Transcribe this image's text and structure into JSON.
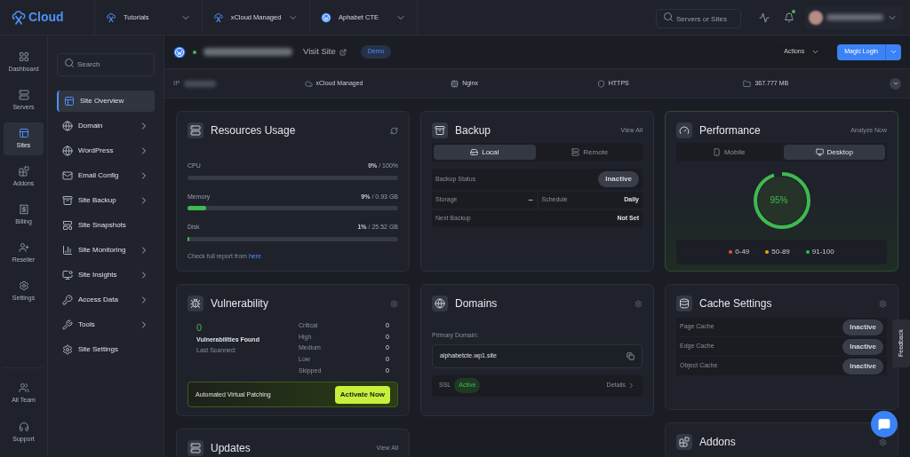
{
  "brand": {
    "name": "Cloud"
  },
  "breadcrumbs": [
    {
      "label": "Tutorials",
      "kind": "team"
    },
    {
      "label": "xCloud Managed",
      "kind": "server"
    },
    {
      "label": "Aphabet CTE",
      "kind": "site"
    }
  ],
  "top_search": {
    "placeholder": "Servers or Sites"
  },
  "notifications": {
    "unread": true
  },
  "rail": [
    {
      "label": "Dashboard",
      "kind": "dashboard",
      "selected": false
    },
    {
      "label": "Servers",
      "kind": "servers",
      "selected": false
    },
    {
      "label": "Sites",
      "kind": "sites",
      "selected": true
    },
    {
      "label": "Addons",
      "kind": "addons",
      "selected": false
    },
    {
      "label": "Billing",
      "kind": "billing",
      "selected": false
    },
    {
      "label": "Reseller",
      "kind": "reseller",
      "selected": false
    },
    {
      "label": "Settings",
      "kind": "settings",
      "selected": false
    }
  ],
  "rail_bottom": [
    {
      "label": "All Team",
      "kind": "team"
    },
    {
      "label": "Support",
      "kind": "support"
    }
  ],
  "nav_search": {
    "placeholder": "Search"
  },
  "nav": [
    {
      "label": "Site Overview",
      "kind": "overview",
      "selected": true,
      "submenu": false
    },
    {
      "label": "Domain",
      "kind": "domain",
      "selected": false,
      "submenu": true
    },
    {
      "label": "WordPress",
      "kind": "wordpress",
      "selected": false,
      "submenu": true
    },
    {
      "label": "Email Config",
      "kind": "email",
      "selected": false,
      "submenu": true
    },
    {
      "label": "Site Backup",
      "kind": "backup",
      "selected": false,
      "submenu": true
    },
    {
      "label": "Site Snapshots",
      "kind": "snapshots",
      "selected": false,
      "submenu": false
    },
    {
      "label": "Site Monitoring",
      "kind": "monitoring",
      "selected": false,
      "submenu": true
    },
    {
      "label": "Site Insights",
      "kind": "insights",
      "selected": false,
      "submenu": true
    },
    {
      "label": "Access Data",
      "kind": "access",
      "selected": false,
      "submenu": true
    },
    {
      "label": "Tools",
      "kind": "tools",
      "selected": false,
      "submenu": true
    },
    {
      "label": "Site Settings",
      "kind": "settings",
      "selected": false,
      "submenu": false
    }
  ],
  "site_header": {
    "online": true,
    "visit_link": "Visit Site",
    "badge": "Demo",
    "actions": "Actions",
    "magic_login": "Magic Login"
  },
  "site_info": {
    "ip_label": "IP",
    "items": [
      {
        "label": "xCloud Managed",
        "kind": "managed"
      },
      {
        "label": "Nginx",
        "kind": "server"
      },
      {
        "label": "HTTPS",
        "kind": "https"
      },
      {
        "label": "367.777 MB",
        "kind": "storage"
      }
    ]
  },
  "resources": {
    "title": "Resources Usage",
    "meters": [
      {
        "name": "CPU",
        "used": "0%",
        "total": "/ 100%",
        "level": 0
      },
      {
        "name": "Memory",
        "used": "9%",
        "total": "/ 0.93 GB",
        "level": 0.09
      },
      {
        "name": "Disk",
        "used": "1%",
        "total": "/ 25.52 GB",
        "level": 0.01
      }
    ],
    "report_text": "Check full report from",
    "report_link": "here"
  },
  "vulnerability": {
    "title": "Vulnerability",
    "count": "0",
    "found_label": "Vulnerabilities Found",
    "scanned_label": "Last Scanned:",
    "levels": [
      {
        "name": "Critical",
        "value": "0"
      },
      {
        "name": "High",
        "value": "0"
      },
      {
        "name": "Medium",
        "value": "0"
      },
      {
        "name": "Low",
        "value": "0"
      },
      {
        "name": "Skipped",
        "value": "0"
      }
    ],
    "patching_label": "Automated Virtual Patching",
    "activate": "Activate Now"
  },
  "updates": {
    "title": "Updates",
    "view_all": "View All"
  },
  "backup": {
    "title": "Backup",
    "view_all": "View All",
    "tabs": [
      {
        "label": "Local",
        "kind": "local",
        "selected": true
      },
      {
        "label": "Remote",
        "kind": "remote",
        "selected": false
      }
    ],
    "status_label": "Backup Status",
    "status": "Inactive",
    "storage_label": "Storage",
    "storage": "--",
    "schedule_label": "Schedule",
    "schedule": "Daily",
    "next_label": "Next Backup",
    "next": "Not Set"
  },
  "domains": {
    "title": "Domains",
    "primary_label": "Primary Domain:",
    "primary": "alphabetcte.wp1.site",
    "ssl_label": "SSL",
    "ssl_status": "Active",
    "details": "Details"
  },
  "performance": {
    "title": "Performance",
    "analyze": "Analyze Now",
    "tabs": [
      {
        "label": "Mobile",
        "kind": "mobile",
        "selected": false
      },
      {
        "label": "Desktop",
        "kind": "desktop",
        "selected": true
      }
    ],
    "score": "95%",
    "level": 0.95,
    "legend": [
      {
        "label": "0-49",
        "color": "#e5533d"
      },
      {
        "label": "50-89",
        "color": "#f59e0b"
      },
      {
        "label": "91-100",
        "color": "#22c55e"
      }
    ]
  },
  "cache": {
    "title": "Cache Settings",
    "rows": [
      {
        "name": "Page Cache",
        "status": "Inactive"
      },
      {
        "name": "Edge Cache",
        "status": "Inactive"
      },
      {
        "name": "Object Cache",
        "status": "Inactive"
      }
    ]
  },
  "addons": {
    "title": "Addons"
  },
  "feedback": "Feedback"
}
